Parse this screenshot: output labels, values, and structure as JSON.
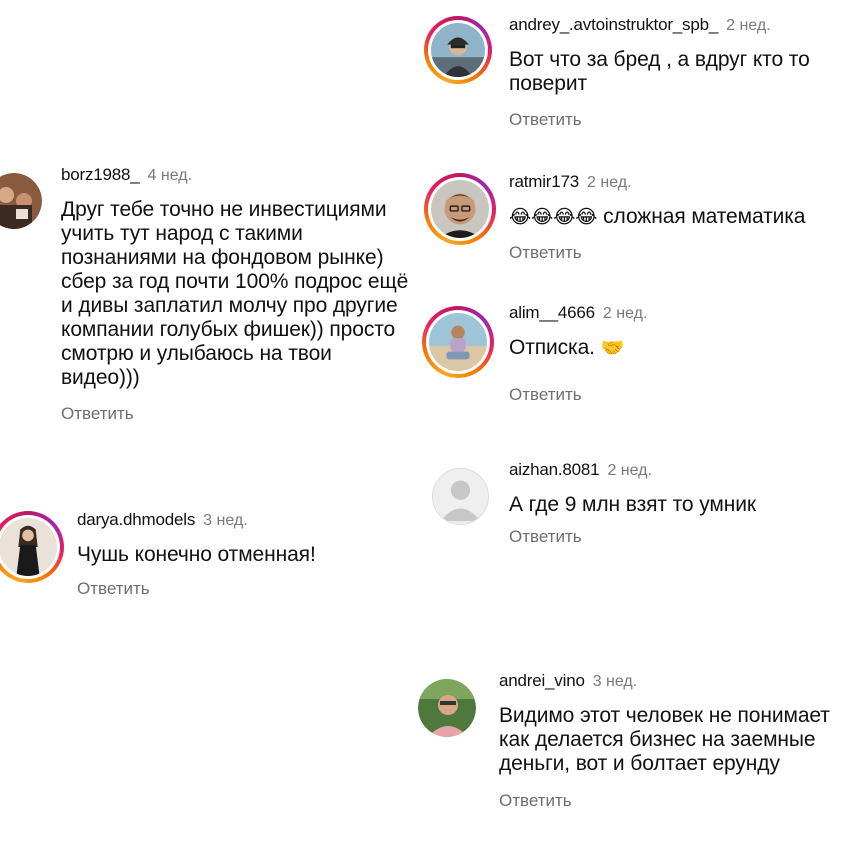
{
  "comments": [
    {
      "username": "andrey_.avtoinstruktor_spb_",
      "time": "2 нед.",
      "text": "Вот что за бред , а вдруг кто то поверит",
      "reply_label": "Ответить",
      "avatar_icon": "user-avatar-icon"
    },
    {
      "username": "borz1988_",
      "time": "4 нед.",
      "text": "Друг тебе точно не инвестициями учить тут народ с такими познаниями на фондовом рынке) сбер за год почти 100% подрос ещё и дивы заплатил молчу про другие компании голубых фишек)) просто смотрю и улыбаюсь на твои видео)))",
      "reply_label": "Ответить",
      "avatar_icon": "user-avatar-icon"
    },
    {
      "username": "ratmir173",
      "time": "2 нед.",
      "text": "сложная математика",
      "emoji": "😂😂😂😂",
      "reply_label": "Ответить",
      "avatar_icon": "user-avatar-icon"
    },
    {
      "username": "alim__4666",
      "time": "2 нед.",
      "text": "Отписка.",
      "emoji": "🤝",
      "reply_label": "Ответить",
      "avatar_icon": "user-avatar-icon"
    },
    {
      "username": "aizhan.8081",
      "time": "2 нед.",
      "text": "А где 9 млн взят то умник",
      "reply_label": "Ответить",
      "avatar_icon": "default-avatar-icon"
    },
    {
      "username": "darya.dhmodels",
      "time": "3 нед.",
      "text": "Чушь конечно отменная!",
      "reply_label": "Ответить",
      "avatar_icon": "user-avatar-icon"
    },
    {
      "username": "andrei_vino",
      "time": "3 нед.",
      "text": "Видимо этот человек не понимает как делается бизнес на заемные деньги, вот и болтает ерунду",
      "reply_label": "Ответить",
      "avatar_icon": "user-avatar-icon"
    }
  ],
  "colors": {
    "story_ring": "#e91e63",
    "reply": "#6e6e6e",
    "time": "#7a7a7a"
  }
}
